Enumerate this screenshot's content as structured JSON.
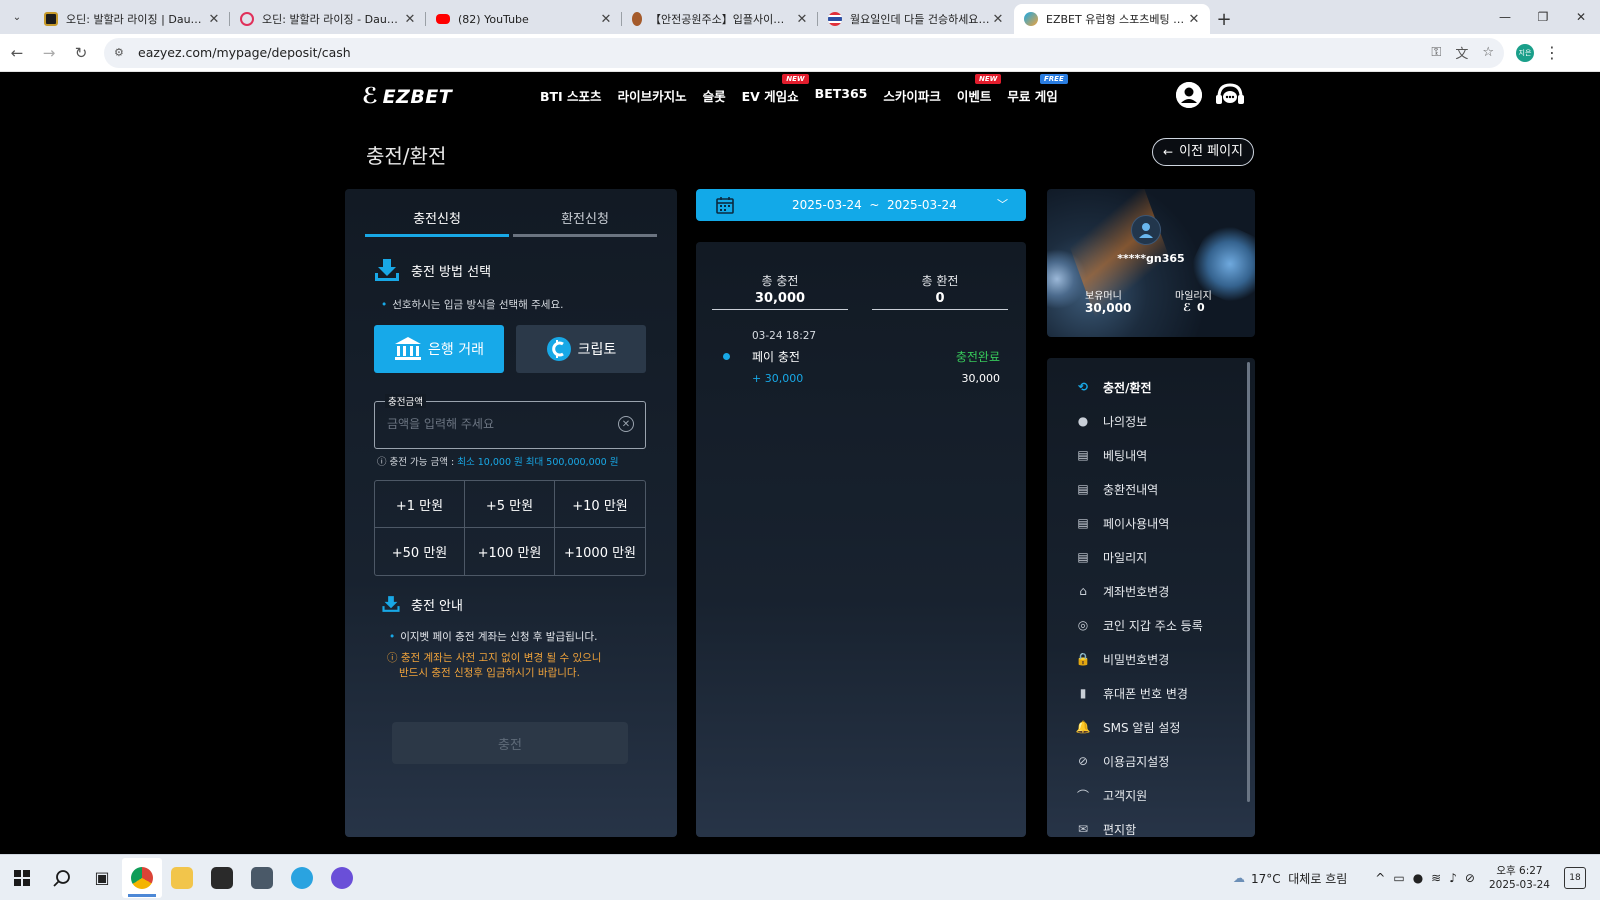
{
  "browser": {
    "tabs": [
      {
        "title": "오딘: 발할라 라이징 | Daum게임",
        "color": "#c79a2a"
      },
      {
        "title": "오딘: 발할라 라이징 - Daum 카페",
        "color": "#e0305a"
      },
      {
        "title": "(82) YouTube",
        "color": "#ff0000"
      },
      {
        "title": "【안전공원주소】입플사이트 이벤트",
        "color": "#a55b2b"
      },
      {
        "title": "월요일인데 다들 건승하세요 - 먹튀",
        "color": "#2c4fa3"
      },
      {
        "title": "EZBET 유럽형 스포츠베팅 이지벳",
        "color": "#18a8e6"
      }
    ],
    "url": "eazyez.com/mypage/deposit/cash",
    "profile_initials": "지은"
  },
  "header": {
    "logo": "EZBET",
    "nav": [
      {
        "label": "BTI 스포츠",
        "badge": ""
      },
      {
        "label": "라이브카지노",
        "badge": ""
      },
      {
        "label": "슬롯",
        "badge": ""
      },
      {
        "label": "EV 게임쇼",
        "badge": "NEW"
      },
      {
        "label": "BET365",
        "badge": ""
      },
      {
        "label": "스카이파크",
        "badge": ""
      },
      {
        "label": "이벤트",
        "badge": "NEW"
      },
      {
        "label": "무료 게임",
        "badge": "FREE"
      }
    ]
  },
  "page": {
    "title": "충전/환전",
    "back_label": "이전 페이지"
  },
  "deposit": {
    "tabs": [
      "충전신청",
      "환전신청"
    ],
    "method_title": "충전 방법 선택",
    "method_hint": "선호하시는 입금 방식을 선택해 주세요.",
    "methods": [
      "은행 거래",
      "크립토"
    ],
    "amount_label": "충전금액",
    "amount_placeholder": "금액을 입력해 주세요",
    "range_prefix": "충전 가능 금액 : ",
    "range_value": "최소 10,000 원 최대 500,000,000 원",
    "quick": [
      "+1 만원",
      "+5 만원",
      "+10 만원",
      "+50 만원",
      "+100 만원",
      "+1000 만원"
    ],
    "guide_title": "충전 안내",
    "guide_note": "이지벳 페이 충전 계좌는 신청 후 발급됩니다.",
    "guide_warning_1": "충전 계좌는 사전 고지 없이 변경 될 수 있으니",
    "guide_warning_2": "반드시 충전 신청후 입금하시기 바랍니다.",
    "submit": "충전"
  },
  "history": {
    "date_range": "2025-03-24  ~  2025-03-24",
    "total_deposit_label": "총 충전",
    "total_deposit": "30,000",
    "total_withdraw_label": "총 환전",
    "total_withdraw": "0",
    "tx": {
      "datetime": "03-24 18:27",
      "type": "페이 충전",
      "status": "충전완료",
      "plus": "+ 30,000",
      "amount": "30,000"
    }
  },
  "profile": {
    "username": "*****gn365",
    "money_label": "보유머니",
    "money": "30,000",
    "mileage_label": "마일리지",
    "mileage": "0"
  },
  "menu": [
    "충전/환전",
    "나의정보",
    "베팅내역",
    "충환전내역",
    "페이사용내역",
    "마일리지",
    "계좌번호변경",
    "코인 지갑 주소 등록",
    "비밀번호변경",
    "휴대폰 번호 변경",
    "SMS 알림 설정",
    "이용금지설정",
    "고객지원",
    "편지함"
  ],
  "taskbar": {
    "weather": "17°C  대체로 흐림",
    "time": "오후 6:27",
    "date": "2025-03-24",
    "notif_count": "18"
  },
  "colors": {
    "accent": "#18a8e6",
    "success": "#37c85a",
    "warning": "#f0a33b"
  }
}
